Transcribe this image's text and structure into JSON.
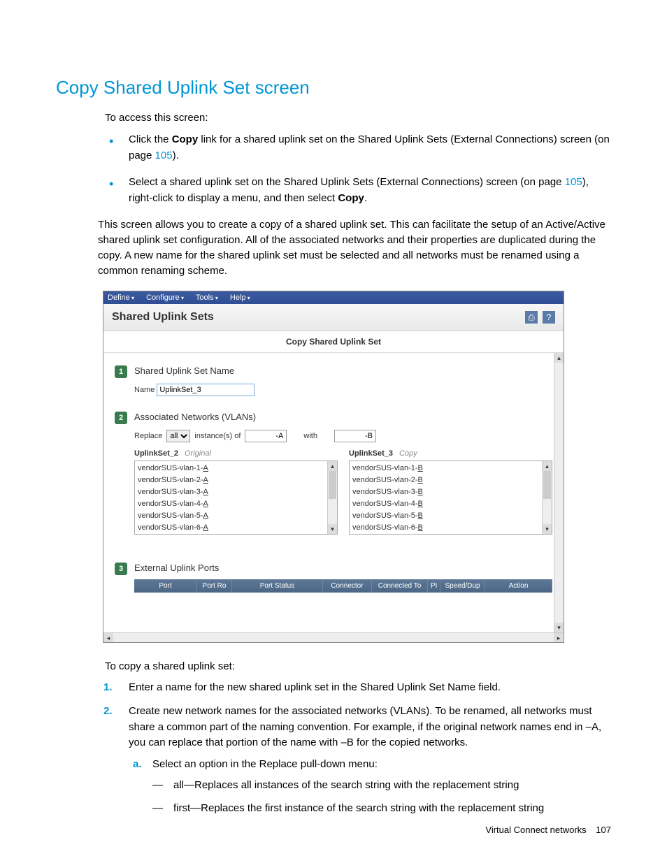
{
  "heading": "Copy Shared Uplink Set screen",
  "intro": "To access this screen:",
  "bullets": [
    {
      "pre": "Click the ",
      "bold": "Copy",
      "post": " link for a shared uplink set on the Shared Uplink Sets (External Connections) screen (on page ",
      "link": "105",
      "tail": ")."
    },
    {
      "pre": "Select a shared uplink set on the Shared Uplink Sets (External Connections) screen (on page ",
      "link": "105",
      "mid": "), right-click to display a menu, and then select ",
      "bold": "Copy",
      "post": "."
    }
  ],
  "body_para": "This screen allows you to create a copy of a shared uplink set. This can facilitate the setup of an Active/Active shared uplink set configuration. All of the associated networks and their properties are duplicated during the copy. A new name for the shared uplink set must be selected and all networks must be renamed using a common renaming scheme.",
  "app": {
    "menus": [
      "Define",
      "Configure",
      "Tools",
      "Help"
    ],
    "title": "Shared Uplink Sets",
    "subtitle": "Copy Shared Uplink Set",
    "step1_label": "Shared Uplink Set Name",
    "name_label": "Name",
    "name_value": "UplinkSet_3",
    "step2_label": "Associated Networks (VLANs)",
    "replace_label": "Replace",
    "replace_scope": "all",
    "replace_mid": "instance(s) of",
    "replace_find": "-A",
    "replace_with_label": "with",
    "replace_with": "-B",
    "orig_set": "UplinkSet_2",
    "orig_tag": "Original",
    "copy_set": "UplinkSet_3",
    "copy_tag": "Copy",
    "orig_vlans": [
      {
        "base": "vendorSUS-vlan-1-",
        "suf": "A"
      },
      {
        "base": "vendorSUS-vlan-2-",
        "suf": "A"
      },
      {
        "base": "vendorSUS-vlan-3-",
        "suf": "A"
      },
      {
        "base": "vendorSUS-vlan-4-",
        "suf": "A"
      },
      {
        "base": "vendorSUS-vlan-5-",
        "suf": "A"
      },
      {
        "base": "vendorSUS-vlan-6-",
        "suf": "A"
      }
    ],
    "copy_vlans": [
      {
        "base": "vendorSUS-vlan-1-",
        "suf": "B"
      },
      {
        "base": "vendorSUS-vlan-2-",
        "suf": "B"
      },
      {
        "base": "vendorSUS-vlan-3-",
        "suf": "B"
      },
      {
        "base": "vendorSUS-vlan-4-",
        "suf": "B"
      },
      {
        "base": "vendorSUS-vlan-5-",
        "suf": "B"
      },
      {
        "base": "vendorSUS-vlan-6-",
        "suf": "B"
      }
    ],
    "step3_label": "External Uplink Ports",
    "grid_headers": {
      "port": "Port",
      "role": "Port Ro",
      "status": "Port Status",
      "connector": "Connector",
      "to": "Connected To",
      "pi": "PI",
      "speed": "Speed/Dup",
      "action": "Action"
    }
  },
  "post_intro": "To copy a shared uplink set:",
  "steps": [
    {
      "text": "Enter a name for the new shared uplink set in the Shared Uplink Set Name field."
    },
    {
      "text": "Create new network names for the associated networks (VLANs). To be renamed, all networks must share a common part of the naming convention. For example, if the original network names end in –A, you can replace that portion of the name with –B for the copied networks.",
      "alpha": [
        {
          "text": "Select an option in the Replace pull-down menu:",
          "dashes": [
            "all—Replaces all instances of the search string with the replacement string",
            "first—Replaces the first instance of the search string with the replacement string"
          ]
        }
      ]
    }
  ],
  "footer_section": "Virtual Connect networks",
  "footer_page": "107"
}
